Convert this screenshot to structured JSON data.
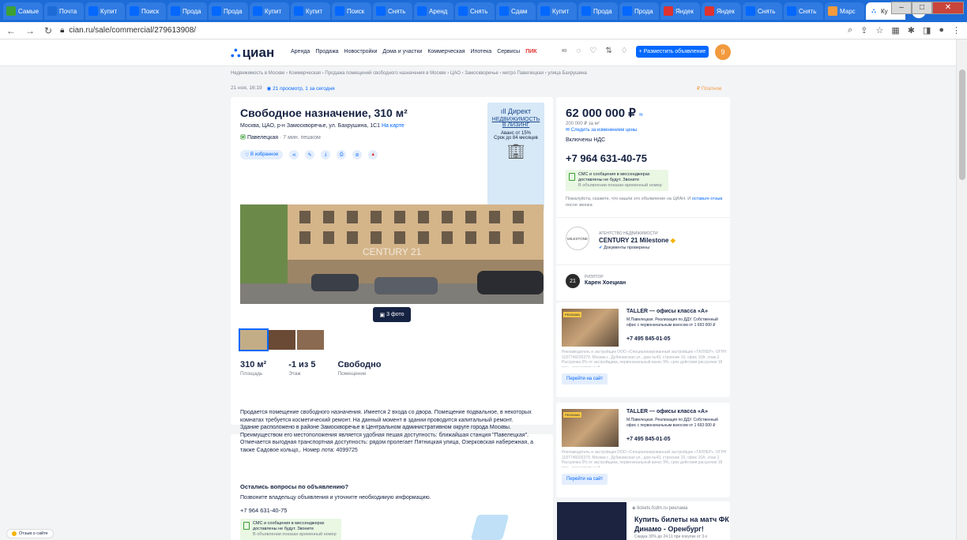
{
  "browser": {
    "tabs": [
      {
        "label": "Самые",
        "icon": "yandex-icon",
        "color": "#3ca035"
      },
      {
        "label": "Почта",
        "icon": "mail-icon",
        "color": "#1d6bd6"
      },
      {
        "label": "Купит",
        "icon": "cian-icon",
        "color": "#0468ff"
      },
      {
        "label": "Поиск",
        "icon": "cian-icon",
        "color": "#0468ff"
      },
      {
        "label": "Прода",
        "icon": "cian-icon",
        "color": "#0468ff"
      },
      {
        "label": "Прода",
        "icon": "cian-icon",
        "color": "#0468ff"
      },
      {
        "label": "Купит",
        "icon": "cian-icon",
        "color": "#0468ff"
      },
      {
        "label": "Купит",
        "icon": "cian-icon",
        "color": "#0468ff"
      },
      {
        "label": "Поиск",
        "icon": "cian-icon",
        "color": "#0468ff"
      },
      {
        "label": "Снять",
        "icon": "cian-icon",
        "color": "#0468ff"
      },
      {
        "label": "Аренд",
        "icon": "cian-icon",
        "color": "#0468ff"
      },
      {
        "label": "Снять",
        "icon": "cian-icon",
        "color": "#0468ff"
      },
      {
        "label": "Сдам",
        "icon": "cian-icon",
        "color": "#0468ff"
      },
      {
        "label": "Купит",
        "icon": "cian-icon",
        "color": "#0468ff"
      },
      {
        "label": "Прода",
        "icon": "cian-icon",
        "color": "#0468ff"
      },
      {
        "label": "Прода",
        "icon": "cian-icon",
        "color": "#0468ff"
      },
      {
        "label": "Яндек",
        "icon": "yandex-icon",
        "color": "#e0322f"
      },
      {
        "label": "Яндек",
        "icon": "maps-icon",
        "color": "#e0322f"
      },
      {
        "label": "Снять",
        "icon": "cian-icon",
        "color": "#0468ff"
      },
      {
        "label": "Снять",
        "icon": "cian-icon",
        "color": "#0468ff"
      },
      {
        "label": "Марс",
        "icon": "market-icon",
        "color": "#f29a3d"
      }
    ],
    "active_tab": {
      "label": "Ку"
    },
    "url": "cian.ru/sale/commercial/279613908/"
  },
  "header": {
    "logo": "циан",
    "nav": [
      "Аренда",
      "Продажа",
      "Новостройки",
      "Дома и участки",
      "Коммерческая",
      "Ипотека",
      "Сервисы"
    ],
    "pik": "ПИК",
    "post_button": "+ Разместить объявление",
    "avatar_letter": "9"
  },
  "breadcrumbs": "Недвижимость в Москве  ›  Коммерческая  ›  Продажа помещений свободного назначения в Москве  ›  ЦАО  ›  Замоскворечье  ›  метро Павелецкая  ›  улица Бахрушина",
  "meta": {
    "date": "21 ноя, 16:19",
    "views": "21 просмотр, 1 за сегодня",
    "paid": "₽ Платное"
  },
  "listing": {
    "title": "Свободное назначение, 310 м²",
    "address": "Москва, ЦАО, р-н Замоскворечье, ул. Бахрушина, 1С1",
    "map_link": "На карте",
    "metro": "Павелецкая",
    "walk": "· 7 мин. пешком",
    "favorite": "В избранное",
    "photos_button": "3 фото",
    "watermark": "CENTURY 21",
    "stats": [
      {
        "value": "310 м²",
        "label": "Площадь"
      },
      {
        "value": "-1 из 5",
        "label": "Этаж"
      },
      {
        "value": "Свободно",
        "label": "Помещение"
      }
    ],
    "description": "Продается помещение свободного назначения. Имеется 2 входа со двора. Помещение подвальное, в некоторых комнатах требуется косметический ремонт. На данный момент в здании проводится капитальный ремонт.\nЗдание расположено в районе Замоскворечье в Центральном административном округе города Москвы. Преимуществом его местоположения является удобная пешая доступность: ближайшая станция \"Павелецкая\". Отмечается выгодная транспортная доступность: рядом пролегает Пятницкая улица, Озерковская набережная, а также Садовое кольцо,. Номер лота: 4099725",
    "questions_title": "Остались вопросы по объявлению?",
    "questions_text": "Позвоните владельцу объявления и уточните необходимую информацию.",
    "phone": "+7 964 631-40-75"
  },
  "direct_ad": {
    "brand": "Директ",
    "line1": "НЕДВИЖИМОСТЬ",
    "line2": "В ЛИЗИНГ",
    "line3": "Аванс от 15%",
    "line4": "Срок до 84 месяцев"
  },
  "sidebar": {
    "price": "62 000 000 ₽",
    "price_per_m": "200 000 ₽ за м²",
    "follow": "Следить за изменением цены",
    "vat": "Включены НДС",
    "phone": "+7 964 631-40-75",
    "sms_title": "СМС и сообщения в мессенджерах доставлены не будут. Звоните",
    "sms_sub": "В объявлении показан временный номер",
    "note": "Пожалуйста, скажите, что нашли это объявление на ЦИАН. И",
    "note_link": "оставьте отзыв",
    "note_tail": "после звонка",
    "agency_type": "АГЕНТСТВО НЕДВИЖИМОСТИ",
    "agency_name": "CENTURY 21 Milestone",
    "agency_logo": "MILESTONE",
    "agency_verified": "Документы проверены",
    "realtor_type": "РИЭЛТОР",
    "realtor_name": "Карен Хоециан",
    "realtor_logo": "21"
  },
  "ads": [
    {
      "badge": "РЕКЛАМА",
      "title": "TALLER — офисы класса «А»",
      "sub": "М.Павелецкая. Реализация по ДДУ. Собственный офис с первоначальным взносом от 1 693 000 ₽",
      "phone": "+7 495 845-01-05",
      "disclaimer": "Рекламодатель и застройщик ООО «Специализированный застройщик «ТАЛЛЕР», ОГРН 1187746026379. Москва г., Дубининская ул., дом №43, строение 10, офис 10А, этаж 2. Рассрочка 0% от застройщика, первоначальный взнос 9%, срок действия рассрочки 18 мес., окончательный",
      "button": "Перейти на сайт"
    },
    {
      "badge": "РЕКЛАМА",
      "title": "TALLER — офисы класса «А»",
      "sub": "М.Павелецкая. Реализация по ДДУ. Собственный офис с первоначальным взносом от 1 693 000 ₽",
      "phone": "+7 495 845-01-05",
      "disclaimer": "Рекламодатель и застройщик ООО «Специализированный застройщик «ТАЛЛЕР», ОГРН 1187746026379. Москва г., Дубининская ул., дом №43, строение 10, офис 10А, этаж 2. Рассрочка 0% от застройщика, первоначальный взнос 9%, срок действия рассрочки 18 мес., окончательный",
      "button": "Перейти на сайт"
    }
  ],
  "tickets_ad": {
    "site": "tickets.fcdm.ru",
    "badge": "реклама",
    "title": "Купить билеты на матч ФК Динамо - Оренбург!",
    "sub": "Скидка 30% до 24.11 при покупке от 3-х"
  },
  "feedback": "Отзыв о сайте",
  "colors": {
    "brand": "#0468ff",
    "metro": "#3ca035",
    "pik": "#e0322f"
  }
}
